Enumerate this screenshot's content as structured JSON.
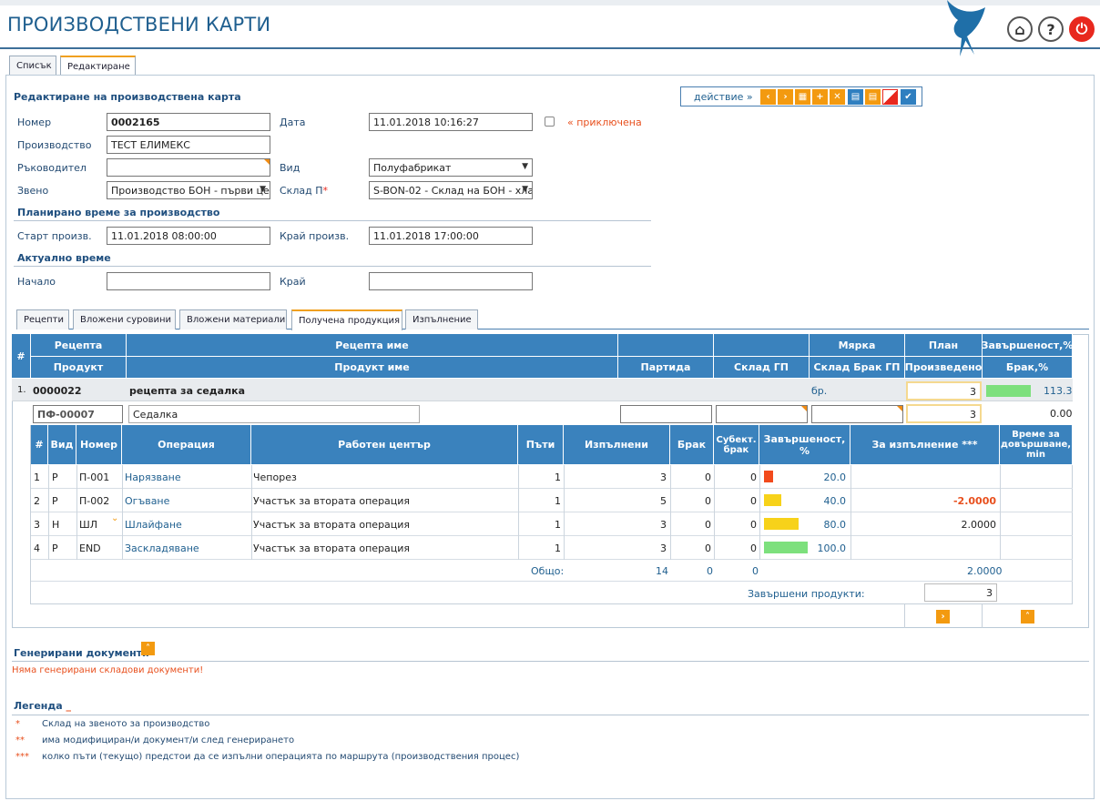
{
  "app": {
    "title": "ПРОИЗВОДСТВЕНИ КАРТИ"
  },
  "header_buttons": {
    "help": "?"
  },
  "main_tabs": [
    {
      "label": "Списък"
    },
    {
      "label": "Редактиране"
    }
  ],
  "form": {
    "title": "Редактиране на производствена карта",
    "number_label": "Номер",
    "number_value": "0002165",
    "date_label": "Дата",
    "date_value": "11.01.2018 10:16:27",
    "closed_label": "« приключена",
    "production_label": "Производство",
    "production_value": "ТЕСТ ЕЛИМЕКС",
    "manager_label": "Ръководител",
    "manager_value": "",
    "type_label": "Вид",
    "type_value": "Полуфабрикат",
    "unit_label": "Звено",
    "unit_value": "Производство БОН - първи це",
    "warehouse_label": "Склад П",
    "warehouse_required": "*",
    "warehouse_value": "S-BON-02 - Склад на БОН - хла",
    "planned_title": "Планирано време за производство",
    "start_label": "Старт произв.",
    "start_value": "11.01.2018 08:00:00",
    "end_label": "Край произв.",
    "end_value": "11.01.2018 17:00:00",
    "actual_title": "Актуално време",
    "begin_label": "Начало",
    "begin_value": "",
    "finish_label": "Край",
    "finish_value": ""
  },
  "action_bar": {
    "label": "действие »"
  },
  "sub_tabs": [
    {
      "label": "Рецепти"
    },
    {
      "label": "Вложени суровини"
    },
    {
      "label": "Вложени материали"
    },
    {
      "label": "Получена продукция"
    },
    {
      "label": "Изпълнение"
    }
  ],
  "grid": {
    "head_top": {
      "hash": "#",
      "recipe": "Рецепта",
      "recipe_name": "Рецепта име",
      "measure": "Мярка",
      "plan": "План",
      "completeness": "Завършеност,%"
    },
    "head_bottom": {
      "product": "Продукт",
      "product_name": "Продукт име",
      "batch": "Партида",
      "warehouse_gp": "Склад ГП",
      "warehouse_scrap": "Склад Брак ГП",
      "produced": "Произведено",
      "scrap": "Брак,%"
    },
    "row": {
      "index": "1.",
      "recipe": "0000022",
      "recipe_name": "рецепта за седалка",
      "measure": "бр.",
      "plan": "3",
      "completeness": "113.3",
      "completeness_fraction": 1.0,
      "product": "ПФ-00007",
      "product_name": "Седалка",
      "produced": "3",
      "scrap": "0.00"
    }
  },
  "ops": {
    "headers": {
      "hash": "#",
      "kind": "Вид",
      "number": "Номер",
      "operation": "Операция",
      "workcenter": "Работен център",
      "times": "Пъти",
      "done": "Изпълнени",
      "scrap": "Брак",
      "subj_scrap": "Субект. брак",
      "completeness": "Завършеност, %",
      "to_do": "За изпълнение ***",
      "time_left": "Време за довършване, min"
    },
    "rows": [
      {
        "n": "1",
        "kind": "Р",
        "number": "П-001",
        "operation": "Нарязване",
        "workcenter": "Чепорез",
        "times": "1",
        "done": "3",
        "scrap": "0",
        "subj": "0",
        "pct": "20.0",
        "pct_value": 20,
        "color": "#f24a1c",
        "todo": ""
      },
      {
        "n": "2",
        "kind": "Р",
        "number": "П-002",
        "operation": "Огъване",
        "workcenter": "Участък за втората операция",
        "times": "1",
        "done": "5",
        "scrap": "0",
        "subj": "0",
        "pct": "40.0",
        "pct_value": 40,
        "color": "#f7d21a",
        "todo": "-2.0000"
      },
      {
        "n": "3",
        "kind": "Н",
        "number": "ШЛ",
        "operation": "Шлайфане",
        "workcenter": "Участък за втората операция",
        "times": "1",
        "done": "3",
        "scrap": "0",
        "subj": "0",
        "pct": "80.0",
        "pct_value": 80,
        "color": "#f7d21a",
        "todo": "2.0000"
      },
      {
        "n": "4",
        "kind": "Р",
        "number": "END",
        "operation": "Заскладяване",
        "workcenter": "Участък за втората операция",
        "times": "1",
        "done": "3",
        "scrap": "0",
        "subj": "0",
        "pct": "100.0",
        "pct_value": 100,
        "color": "#7de07d",
        "todo": ""
      }
    ],
    "total_label": "Общо:",
    "total_done": "14",
    "total_scrap": "0",
    "total_subj": "0",
    "total_todo": "2.0000",
    "finished_label": "Завършени продукти:",
    "finished_value": "3"
  },
  "generated": {
    "title": "Генерирани документи",
    "message": "Няма генерирани складови документи!"
  },
  "legend": {
    "title": "Легенда",
    "items": [
      {
        "mark": "*",
        "text": "Склад на звеното за производство"
      },
      {
        "mark": "**",
        "text": "има модифициран/и документ/и след генерирането"
      },
      {
        "mark": "***",
        "text": "колко пъти (текущо) предстои да се изпълни операцията по маршрута (производствения процес)"
      }
    ]
  }
}
